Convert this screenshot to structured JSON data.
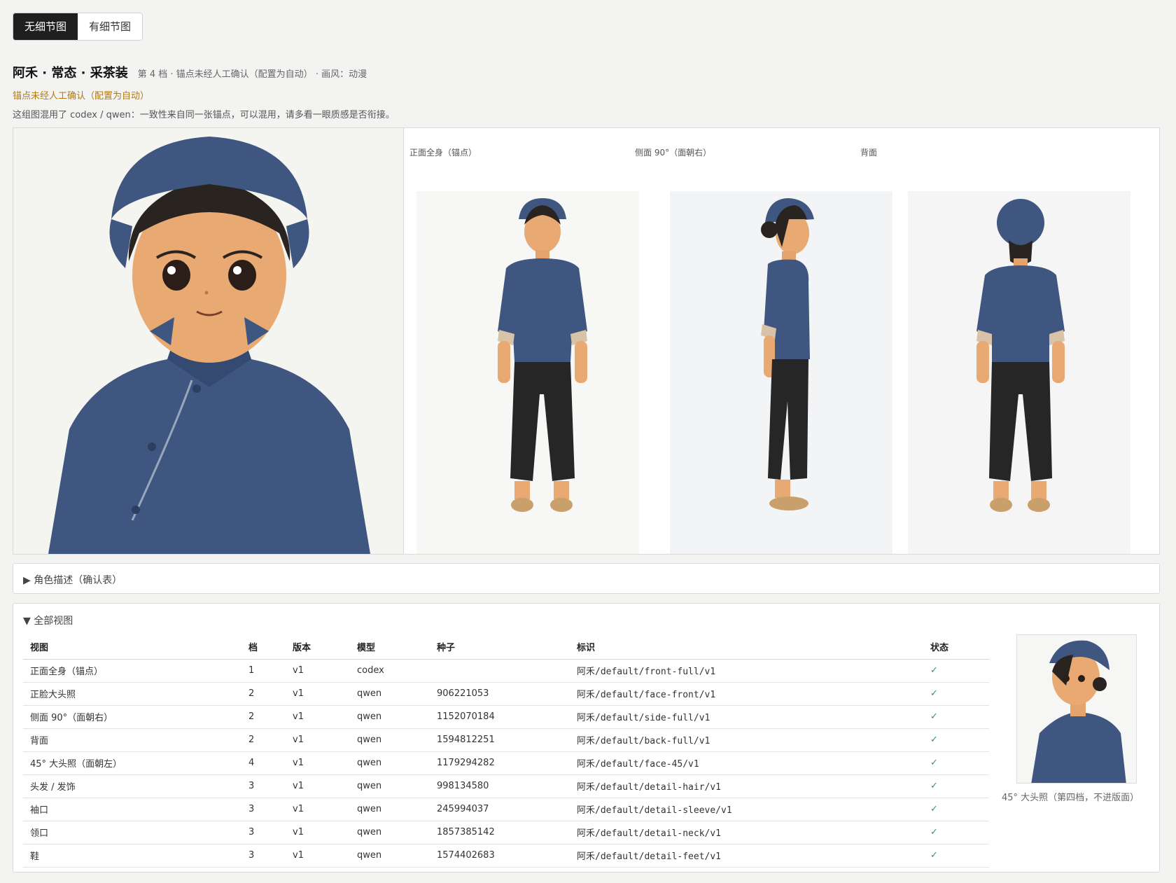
{
  "toggle": {
    "no_detail": "无细节图",
    "with_detail": "有细节图"
  },
  "header": {
    "title": "阿禾 · 常态 · 采茶装",
    "meta": "第 4 档 · 锚点未经人工确认（配置为自动） · 画风：动漫",
    "warning": "锚点未经人工确认（配置为自动）",
    "note": "这组图混用了 codex / qwen：一致性来自同一张锚点，可以混用，请多看一眼质感是否衔接。"
  },
  "gallery": {
    "front_label": "正面全身（锚点）",
    "side_label": "侧面 90°（面朝右）",
    "back_label": "背面"
  },
  "description_panel": {
    "summary": "▶ 角色描述（确认表）"
  },
  "views_panel": {
    "summary": "▼ 全部视图",
    "columns": [
      "视图",
      "档",
      "版本",
      "模型",
      "种子",
      "标识",
      "状态"
    ],
    "rows": [
      {
        "view": "正面全身（锚点）",
        "tier": "1",
        "version": "v1",
        "model": "codex",
        "seed": "",
        "id": "阿禾/default/front-full/v1",
        "status": "✓"
      },
      {
        "view": "正脸大头照",
        "tier": "2",
        "version": "v1",
        "model": "qwen",
        "seed": "906221053",
        "id": "阿禾/default/face-front/v1",
        "status": "✓"
      },
      {
        "view": "侧面 90°（面朝右）",
        "tier": "2",
        "version": "v1",
        "model": "qwen",
        "seed": "1152070184",
        "id": "阿禾/default/side-full/v1",
        "status": "✓"
      },
      {
        "view": "背面",
        "tier": "2",
        "version": "v1",
        "model": "qwen",
        "seed": "1594812251",
        "id": "阿禾/default/back-full/v1",
        "status": "✓"
      },
      {
        "view": "45° 大头照（面朝左）",
        "tier": "4",
        "version": "v1",
        "model": "qwen",
        "seed": "1179294282",
        "id": "阿禾/default/face-45/v1",
        "status": "✓"
      },
      {
        "view": "头发 / 发饰",
        "tier": "3",
        "version": "v1",
        "model": "qwen",
        "seed": "998134580",
        "id": "阿禾/default/detail-hair/v1",
        "status": "✓"
      },
      {
        "view": "袖口",
        "tier": "3",
        "version": "v1",
        "model": "qwen",
        "seed": "245994037",
        "id": "阿禾/default/detail-sleeve/v1",
        "status": "✓"
      },
      {
        "view": "领口",
        "tier": "3",
        "version": "v1",
        "model": "qwen",
        "seed": "1857385142",
        "id": "阿禾/default/detail-neck/v1",
        "status": "✓"
      },
      {
        "view": "鞋",
        "tier": "3",
        "version": "v1",
        "model": "qwen",
        "seed": "1574402683",
        "id": "阿禾/default/detail-feet/v1",
        "status": "✓"
      }
    ],
    "thumb_caption": "45° 大头照（第四档，不进版面）"
  },
  "colors": {
    "accent_dark": "#1f1f1f",
    "warning": "#b07a14",
    "jacket": "#3f5680",
    "pants": "#262626",
    "status_ok": "#3a8f6a"
  }
}
